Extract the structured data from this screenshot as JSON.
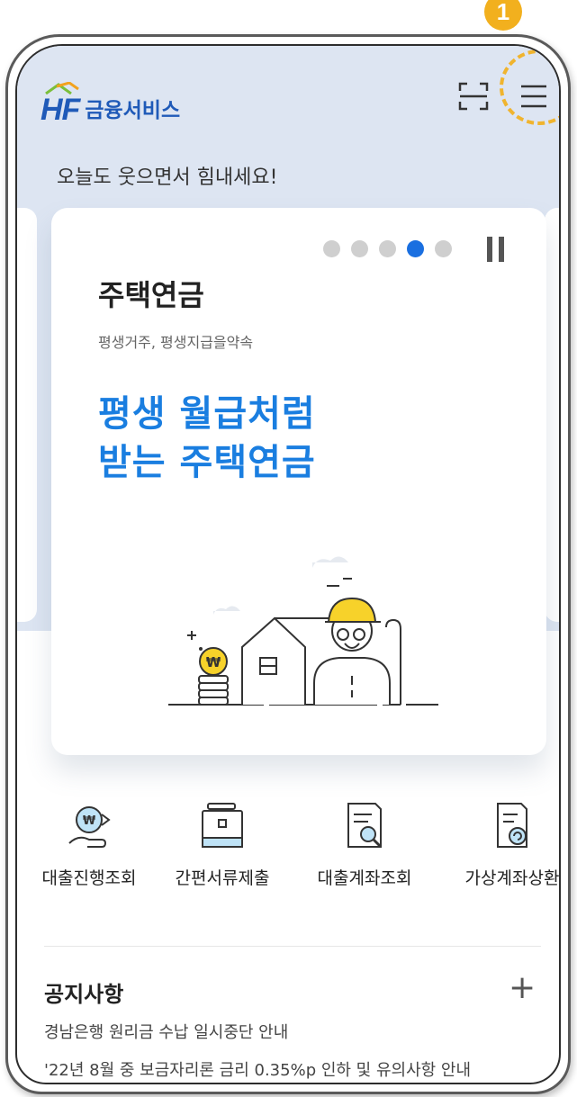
{
  "header": {
    "logo_mark": "HF",
    "logo_text": "금융서비스",
    "step_badge": "1"
  },
  "greeting": "오늘도 웃으면서 힘내세요!",
  "banner": {
    "title": "주택연금",
    "subtitle": "평생거주, 평생지급을약속",
    "headline_line1": "평생 월급처럼",
    "headline_line2": "받는 주택연금",
    "dots_total": 5,
    "active_dot": 4
  },
  "quick_menu": [
    {
      "label": "대출진행조회",
      "icon": "loan-progress-icon"
    },
    {
      "label": "간편서류제출",
      "icon": "document-submit-icon"
    },
    {
      "label": "대출계좌조회",
      "icon": "account-search-icon"
    },
    {
      "label": "가상계좌상환",
      "icon": "virtual-account-icon"
    }
  ],
  "notices": {
    "title": "공지사항",
    "more": "+",
    "items": [
      "경남은행 원리금 수납 일시중단 안내",
      "'22년 8월 중 보금자리론 금리 0.35%p 인하 및 유의사항 안내"
    ]
  },
  "colors": {
    "brand": "#1f5ab8",
    "accent": "#1a7ee0",
    "highlight": "#f2b01e",
    "header_bg": "#dde5f2"
  }
}
